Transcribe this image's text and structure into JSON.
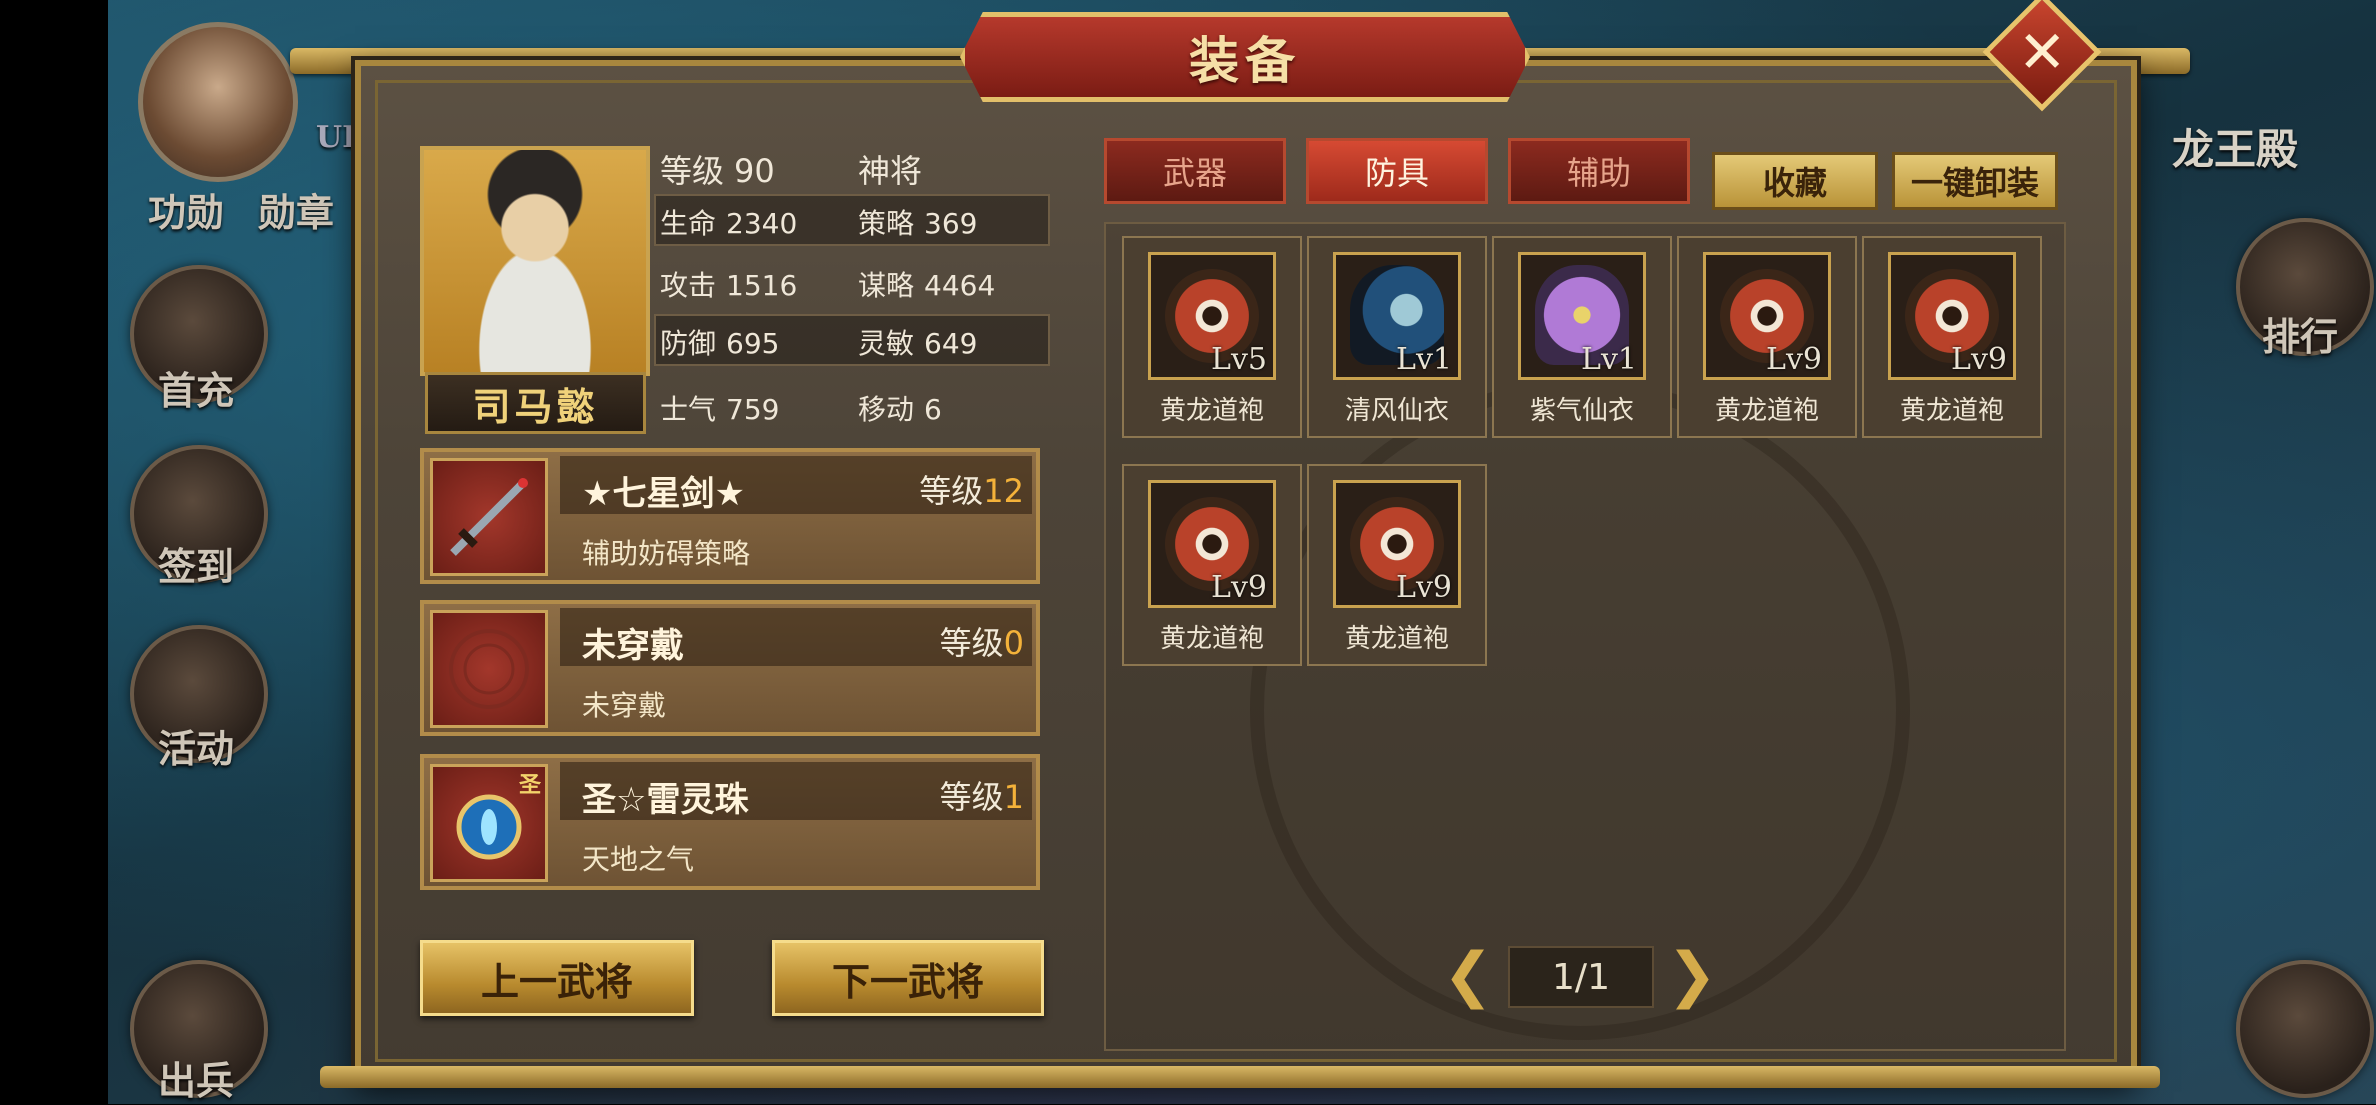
{
  "window": {
    "title": "装备",
    "close_glyph": "✕"
  },
  "background": {
    "left_labels": [
      "功勋",
      "勋章"
    ],
    "side_buttons": [
      "首充",
      "签到",
      "活动",
      "出兵"
    ],
    "right_buttons": [
      "排行"
    ],
    "top_right_text": "龙王殿",
    "top_left_fragment": "UI"
  },
  "hero": {
    "name": "司马懿",
    "stats": {
      "level_label": "等级",
      "level": "90",
      "rank": "神将",
      "hp_label": "生命",
      "hp": "2340",
      "strategy_label": "策略",
      "strategy": "369",
      "attack_label": "攻击",
      "attack": "1516",
      "tactics_label": "谋略",
      "tactics": "4464",
      "defense_label": "防御",
      "defense": "695",
      "agility_label": "灵敏",
      "agility": "649",
      "morale_label": "士气",
      "morale": "759",
      "move_label": "移动",
      "move": "6"
    }
  },
  "equipped": [
    {
      "name": "★七星剑★",
      "level_label": "等级",
      "level": "12",
      "desc": "辅助妨碍策略",
      "icon": "sword-icon"
    },
    {
      "name": "未穿戴",
      "level_label": "等级",
      "level": "0",
      "desc": "未穿戴",
      "icon": "empty-slot-icon"
    },
    {
      "name": "圣☆雷灵珠",
      "level_label": "等级",
      "level": "1",
      "desc": "天地之气",
      "icon": "orb-icon",
      "badge": "圣"
    }
  ],
  "nav": {
    "prev_hero": "上一武将",
    "next_hero": "下一武将"
  },
  "tabs": [
    {
      "label": "武器",
      "active": false
    },
    {
      "label": "防具",
      "active": true
    },
    {
      "label": "辅助",
      "active": false
    }
  ],
  "tools": {
    "favorite": "收藏",
    "unequip_all": "一键卸装"
  },
  "inventory": [
    {
      "name": "黄龙道袍",
      "level": "Lv5",
      "icon": "robe-red"
    },
    {
      "name": "清风仙衣",
      "level": "Lv1",
      "icon": "robe-blue"
    },
    {
      "name": "紫气仙衣",
      "level": "Lv1",
      "icon": "robe-purple"
    },
    {
      "name": "黄龙道袍",
      "level": "Lv9",
      "icon": "robe-red"
    },
    {
      "name": "黄龙道袍",
      "level": "Lv9",
      "icon": "robe-red"
    },
    {
      "name": "黄龙道袍",
      "level": "Lv9",
      "icon": "robe-red"
    },
    {
      "name": "黄龙道袍",
      "level": "Lv9",
      "icon": "robe-red"
    }
  ],
  "pager": {
    "text": "1/1",
    "prev_glyph": "❮",
    "next_glyph": "❯"
  },
  "colors": {
    "accent_gold": "#d4ab4a",
    "tab_red": "#b6492f",
    "level_orange": "#f4b23a"
  }
}
